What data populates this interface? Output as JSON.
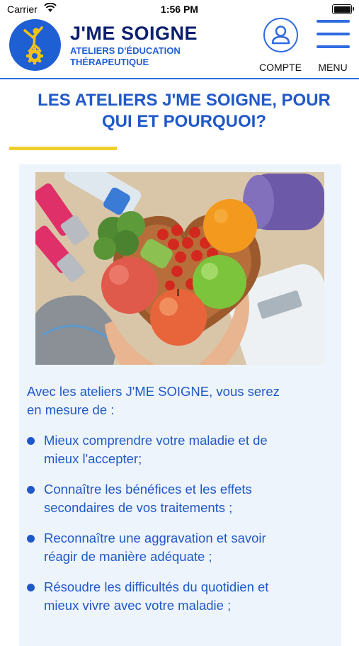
{
  "status_bar": {
    "carrier": "Carrier",
    "time": "1:56 PM"
  },
  "header": {
    "brand_title": "J'ME SOIGNE",
    "brand_subtitle_line1": "ATELIERS D'ÉDUCATION",
    "brand_subtitle_line2": "THÉRAPEUTIQUE",
    "account_label": "COMPTE",
    "menu_label": "MENU"
  },
  "main": {
    "heading_line1": "LES ATELIERS J'ME SOIGNE, POUR",
    "heading_line2": "QUI ET POURQUOI?",
    "intro_line1": "Avec les ateliers J'ME SOIGNE, vous serez",
    "intro_line2": "en mesure de :",
    "bullets": [
      {
        "line1": "Mieux comprendre votre maladie et de",
        "line2": "mieux l'accepter;"
      },
      {
        "line1": "Connaître les bénéfices et les effets",
        "line2": "secondaires de vos traitements ;"
      },
      {
        "line1": "Reconnaître une aggravation et savoir",
        "line2": "réagir de manière adéquate ;"
      },
      {
        "line1": "Résoudre les difficultés du quotidien et",
        "line2": "mieux vivre avec votre maladie ;"
      }
    ]
  },
  "colors": {
    "primary_blue": "#2058c8",
    "navy": "#0a1e6e",
    "accent_yellow": "#f0cf2c",
    "card_background": "#eef4fc"
  },
  "icons": [
    "wifi-icon",
    "battery-icon",
    "logo-icon",
    "account-icon",
    "hamburger-menu-icon",
    "bullet-dot-icon"
  ]
}
